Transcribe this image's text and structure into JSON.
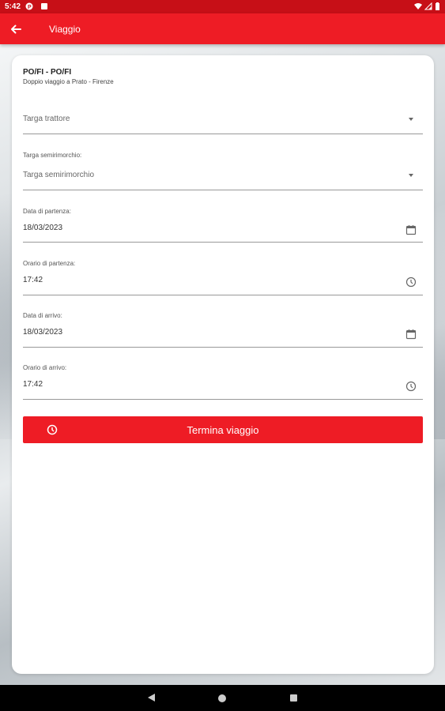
{
  "status_bar": {
    "time": "5:42"
  },
  "app_bar": {
    "title": "Viaggio",
    "back_icon": "arrow-back-icon"
  },
  "trip": {
    "code": "PO/FI - PO/FI",
    "description": "Doppio viaggio a Prato - Firenze"
  },
  "fields": {
    "targa_trattore": {
      "placeholder": "Targa trattore"
    },
    "targa_semirimorchio": {
      "label": "Targa semirimorchio:",
      "placeholder": "Targa semirimorchio"
    },
    "data_partenza": {
      "label": "Data di partenza:",
      "value": "18/03/2023"
    },
    "orario_partenza": {
      "label": "Orario di partenza:",
      "value": "17:42"
    },
    "data_arrivo": {
      "label": "Data di arrivo:",
      "value": "18/03/2023"
    },
    "orario_arrivo": {
      "label": "Orario di arrivo:",
      "value": "17:42"
    }
  },
  "action_button": {
    "label": "Termina viaggio",
    "icon": "clock-icon"
  },
  "colors": {
    "primary": "#ee1c25",
    "status_bar": "#c70f17"
  }
}
